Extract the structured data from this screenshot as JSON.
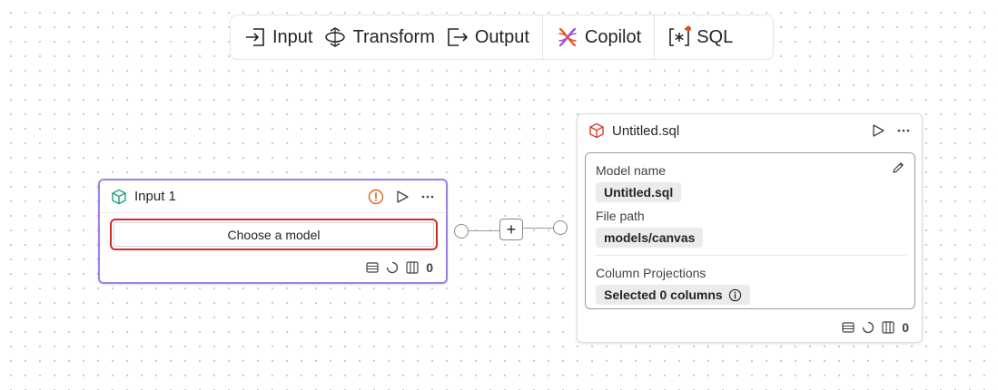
{
  "toolbar": {
    "input_label": "Input",
    "transform_label": "Transform",
    "output_label": "Output",
    "copilot_label": "Copilot",
    "sql_label": "SQL",
    "icons": [
      "input-icon",
      "transform-icon",
      "output-icon",
      "copilot-icon",
      "sql-icon"
    ]
  },
  "input_node": {
    "title": "Input 1",
    "choose_model_label": "Choose a model",
    "column_count": "0",
    "status": "warning",
    "border_color": "#9b82e6"
  },
  "sql_node": {
    "title": "Untitled.sql",
    "model_name_label": "Model name",
    "model_name_value": "Untitled.sql",
    "file_path_label": "File path",
    "file_path_value": "models/canvas",
    "column_projections_label": "Column Projections",
    "column_projections_value": "Selected 0 columns",
    "column_count": "0",
    "icon_color": "#d93f2a"
  },
  "colors": {
    "accent_purple": "#9b82e6",
    "error_red": "#d42a2a",
    "warning_orange": "#d9651e"
  }
}
